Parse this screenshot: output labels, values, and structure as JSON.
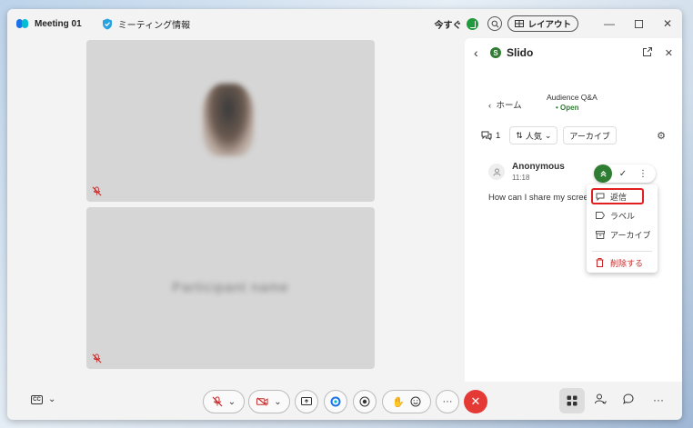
{
  "titlebar": {
    "meeting_title": "Meeting 01",
    "info_label": "ミーティング情報",
    "now_label": "今すぐ",
    "layout_label": "レイアウト",
    "window_controls": [
      "minimize-icon",
      "maximize-icon",
      "close-icon"
    ]
  },
  "video": {
    "tile2_name": "Participant name"
  },
  "panel": {
    "title": "Slido",
    "back_home": "ホーム",
    "qa_title": "Audience Q&A",
    "qa_status": "• Open",
    "question_count": "1",
    "sort_label": "人気",
    "archive_chip": "アーカイブ",
    "question": {
      "author": "Anonymous",
      "time": "11:18",
      "text": "How can I share my screen"
    },
    "menu": {
      "reply": "返信",
      "label": "ラベル",
      "archive": "アーカイブ",
      "delete": "削除する"
    }
  },
  "colors": {
    "accent_green": "#2e7d32",
    "end_call_red": "#e53935",
    "highlight_red": "#e0201f"
  }
}
